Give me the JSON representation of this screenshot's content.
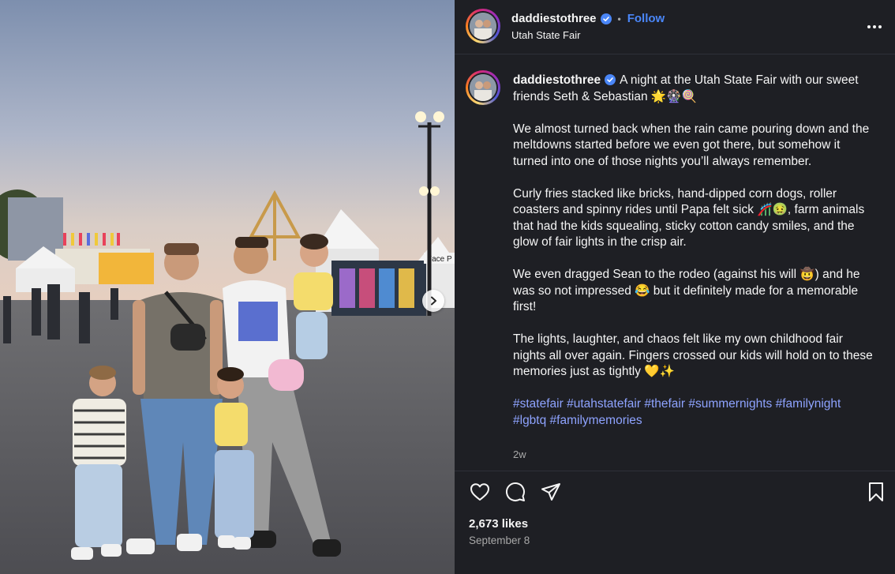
{
  "post": {
    "username": "daddiestothree",
    "location": "Utah State Fair",
    "follow_label": "Follow",
    "separator": "•",
    "caption": {
      "username": "daddiestothree",
      "p1": "A night at the Utah State Fair with our sweet friends Seth & Sebastian 🌟🎡🍭",
      "p2": "We almost turned back when the rain came pouring down and the meltdowns started before we even got there, but somehow it turned into one of those nights you’ll always remember.",
      "p3": "Curly fries stacked like bricks, hand-dipped corn dogs, roller coasters and spinny rides until Papa felt sick 🎢🤢, farm animals that had the kids squealing, sticky cotton candy smiles, and the glow of fair lights in the crisp air.",
      "p4": "We even dragged Sean to the rodeo (against his will 🤠) and he was so not impressed 😂 but it definitely made for a memorable first!",
      "p5": "The lights, laughter, and chaos felt like my own childhood fair nights all over again. Fingers crossed our kids will hold on to these memories just as tightly 💛✨",
      "hashtags": [
        "#statefair",
        "#utahstatefair",
        "#thefair",
        "#summernights",
        "#familynight",
        "#lgbtq",
        "#familymemories"
      ]
    },
    "time_ago": "2w",
    "likes": "2,673 likes",
    "date": "September 8"
  },
  "photo": {
    "sign_text": "Face P"
  },
  "icons": {
    "verified": "verified-badge-icon",
    "more": "more-options-icon",
    "like": "heart-icon",
    "comment": "comment-icon",
    "share": "share-icon",
    "save": "bookmark-icon",
    "next": "chevron-right-icon"
  },
  "colors": {
    "panel_bg": "#1e1f24",
    "accent": "#4a86f7",
    "hashtag": "#8ea3ff",
    "muted": "#a8a8a8"
  }
}
